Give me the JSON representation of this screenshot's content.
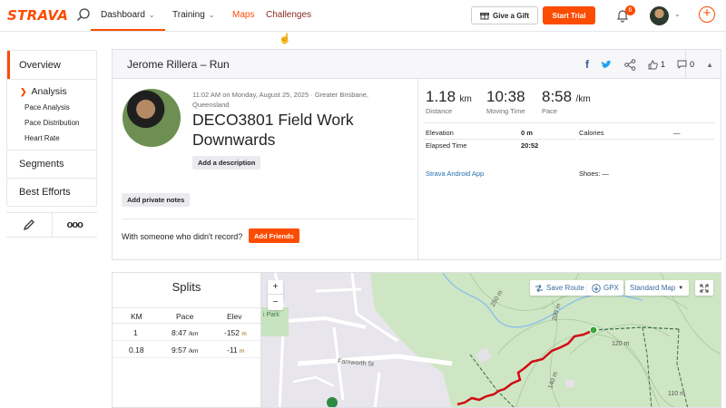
{
  "nav": {
    "logo": "STRAVA",
    "dashboard": "Dashboard",
    "training": "Training",
    "maps": "Maps",
    "challenges": "Challenges",
    "give_gift": "Give a Gift",
    "start_trial": "Start Trial",
    "notification_count": "6"
  },
  "sidebar": {
    "overview": "Overview",
    "analysis": "Analysis",
    "pace_analysis": "Pace Analysis",
    "pace_distribution": "Pace Distribution",
    "heart_rate": "Heart Rate",
    "segments": "Segments",
    "best_efforts": "Best Efforts",
    "more": "ooo"
  },
  "activity": {
    "header_title": "Jerome Rillera – Run",
    "kudos_count": "1",
    "comment_count": "0",
    "meta": "11:02 AM on Monday, August 25, 2025 · Greater Brisbane, Queensland",
    "title": "DECO3801 Field Work Downwards",
    "add_description": "Add a description",
    "add_private_notes": "Add private notes",
    "with_someone": "With someone who didn't record?",
    "add_friends": "Add Friends"
  },
  "stats": {
    "distance_value": "1.18",
    "distance_unit": "km",
    "distance_label": "Distance",
    "moving_time_value": "10:38",
    "moving_time_label": "Moving Time",
    "pace_value": "8:58",
    "pace_unit": "/km",
    "pace_label": "Pace",
    "elevation_label": "Elevation",
    "elevation_value": "0 m",
    "elapsed_label": "Elapsed Time",
    "elapsed_value": "20:52",
    "calories_label": "Calories",
    "calories_value": "—",
    "device": "Strava Android App",
    "shoes": "Shoes: —"
  },
  "splits": {
    "title": "Splits",
    "headers": [
      "KM",
      "Pace",
      "Elev"
    ],
    "rows": [
      {
        "km": "1",
        "pace": "8:47",
        "pace_unit": "/km",
        "elev": "-152",
        "elev_unit": "m"
      },
      {
        "km": "0.18",
        "pace": "9:57",
        "pace_unit": "/km",
        "elev": "-11",
        "elev_unit": "m"
      }
    ]
  },
  "map": {
    "save_route": "Save Route",
    "gpx": "GPX",
    "standard_map": "Standard Map",
    "zoom_in": "+",
    "zoom_out": "−",
    "street": "Farnworth St",
    "park": "i Park",
    "contour_110": "110 m",
    "contour_120": "120 m",
    "contour_250": "250 m",
    "contour_200": "200 m",
    "contour_140": "140 m"
  }
}
